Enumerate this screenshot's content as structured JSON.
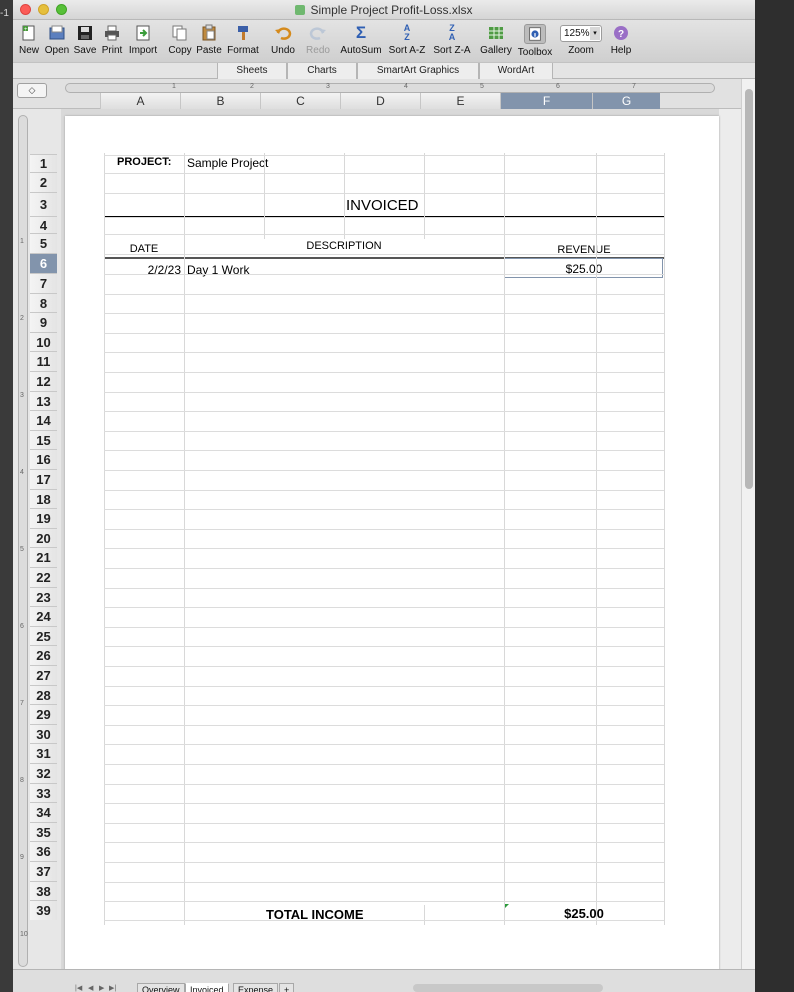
{
  "window": {
    "title": "Simple Project Profit-Loss.xlsx",
    "desktop_edge_text": "-1"
  },
  "toolbar": {
    "new": "New",
    "open": "Open",
    "save": "Save",
    "print": "Print",
    "import": "Import",
    "copy": "Copy",
    "paste": "Paste",
    "format": "Format",
    "undo": "Undo",
    "redo": "Redo",
    "autosum": "AutoSum",
    "sort_az": "Sort A-Z",
    "sort_za": "Sort Z-A",
    "gallery": "Gallery",
    "toolbox": "Toolbox",
    "zoom": "Zoom",
    "zoom_value": "125%",
    "help": "Help"
  },
  "ribbon": {
    "tabs": [
      "Sheets",
      "Charts",
      "SmartArt Graphics",
      "WordArt"
    ]
  },
  "columns": [
    "A",
    "B",
    "C",
    "D",
    "E",
    "F",
    "G"
  ],
  "selected_column": "F",
  "selected_row": 6,
  "ruler_top": [
    "1",
    "2",
    "3",
    "4",
    "5",
    "6",
    "7"
  ],
  "ruler_left": [
    "1",
    "2",
    "3",
    "4",
    "5",
    "6",
    "7",
    "8",
    "9",
    "10"
  ],
  "rows": [
    "1",
    "2",
    "3",
    "4",
    "5",
    "6",
    "7",
    "8",
    "9",
    "10",
    "11",
    "12",
    "13",
    "14",
    "15",
    "16",
    "17",
    "18",
    "19",
    "20",
    "21",
    "22",
    "23",
    "24",
    "25",
    "26",
    "27",
    "28",
    "29",
    "30",
    "31",
    "32",
    "33",
    "34",
    "35",
    "36",
    "37",
    "38",
    "39"
  ],
  "sheet": {
    "project_label": "PROJECT:",
    "project_name": "Sample Project",
    "heading": "INVOICED",
    "col_date": "DATE",
    "col_description": "DESCRIPTION",
    "col_revenue": "REVENUE",
    "entries": [
      {
        "date": "2/2/23",
        "description": "Day 1 Work",
        "revenue": "$25.00"
      }
    ],
    "total_label": "TOTAL INCOME",
    "total_value": "$25.00"
  },
  "sheet_tabs": {
    "items": [
      "Overview",
      "Invoiced",
      "Expense"
    ],
    "active": "Invoiced",
    "add": "+"
  },
  "colors": {
    "selection": "#8294ac",
    "close": "#fc5b57",
    "minimize": "#e5bf3c",
    "zoom": "#57c038"
  }
}
